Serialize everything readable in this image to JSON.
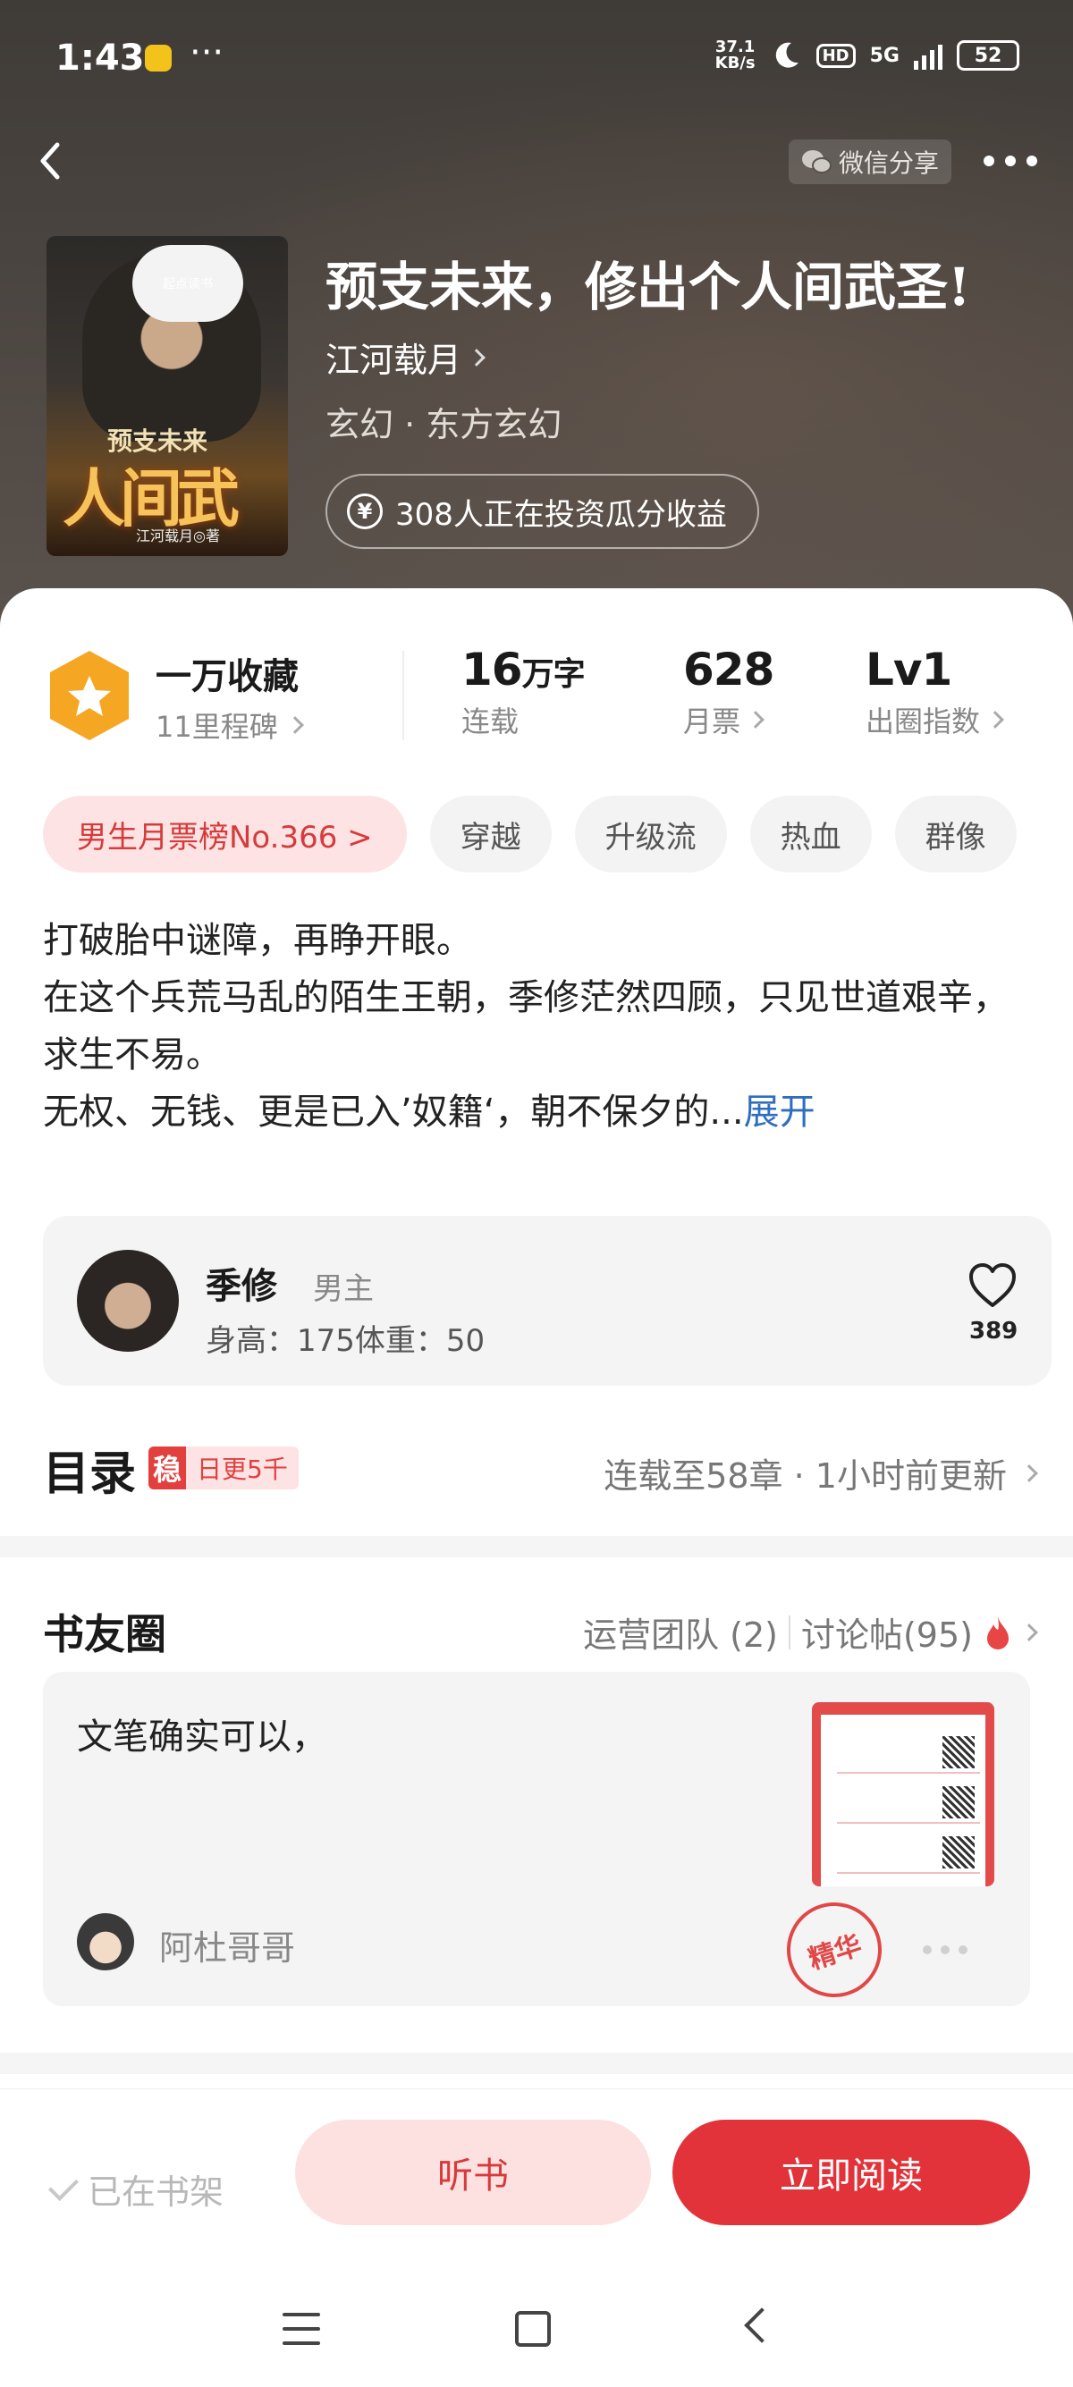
{
  "status_bar": {
    "time": "1:43",
    "more": "···",
    "net_speed_value": "37.1",
    "net_speed_unit": "KB/s",
    "hd": "HD",
    "network": "5G",
    "battery": "52"
  },
  "header": {
    "share_label": "微信分享",
    "book": {
      "title": "预支未来，修出个人间武圣!",
      "author": "江河载月",
      "category": "玄幻 · 东方玄幻",
      "invest_text": "308人正在投资瓜分收益",
      "invest_icon": "¥"
    },
    "cover": {
      "publisher": "起点读书",
      "small_title": "预支未来",
      "big_title": "人间武圣",
      "author_line": "江河载月◎著"
    }
  },
  "stats": {
    "collect_title": "一万收藏",
    "collect_sub": "11里程碑",
    "words_value": "16",
    "words_unit": "万字",
    "words_label": "连载",
    "votes_value": "628",
    "votes_label": "月票",
    "level_value": "Lv1",
    "level_label": "出圈指数"
  },
  "tags": [
    {
      "label": "男生月票榜No.366 >"
    },
    {
      "label": "穿越"
    },
    {
      "label": "升级流"
    },
    {
      "label": "热血"
    },
    {
      "label": "群像"
    }
  ],
  "intro": {
    "line1": "打破胎中谜障，再睁开眼。",
    "line2": "在这个兵荒马乱的陌生王朝，季修茫然四顾，只见世道艰辛，求生不易。",
    "line3": "无权、无钱、更是已入’奴籍‘，朝不保夕的...",
    "expand": "展开"
  },
  "character": {
    "name": "季修",
    "role": "男主",
    "info": "身高：175体重：50",
    "likes": "389"
  },
  "toc": {
    "title": "目录",
    "badge_icon": "稳",
    "badge_text": "日更5千",
    "status": "连载至58章 · 1小时前更新"
  },
  "book_circle": {
    "title": "书友圈",
    "team": "运营团队 (2)",
    "posts": "讨论帖(95)",
    "post": {
      "text": "文笔确实可以，",
      "user": "阿杜哥哥",
      "stamp": "精华"
    }
  },
  "bottom_bar": {
    "shelf": "已在书架",
    "listen": "听书",
    "read": "立即阅读"
  },
  "colors": {
    "accent_red": "#e2333a",
    "light_red": "#fde1e1",
    "link_blue": "#2f6ebf",
    "badge_orange": "#f5a623"
  }
}
